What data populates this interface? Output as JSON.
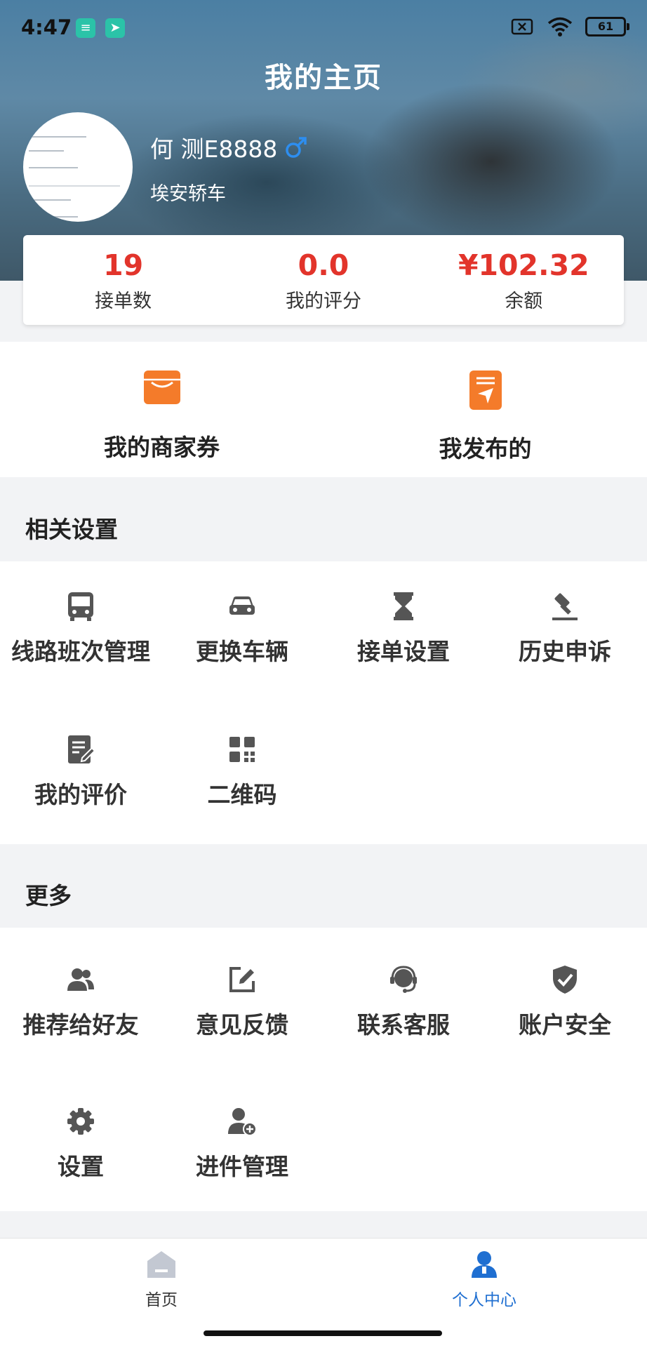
{
  "status_bar": {
    "time": "4:47",
    "battery": "61"
  },
  "header": {
    "title": "我的主页",
    "user_name": "何 测E8888",
    "car_type": "埃安轿车"
  },
  "stats": [
    {
      "value": "19",
      "label": "接单数"
    },
    {
      "value": "0.0",
      "label": "我的评分"
    },
    {
      "value": "¥102.32",
      "label": "余额"
    }
  ],
  "quick": [
    {
      "label": "我的商家券",
      "icon": "wallet-icon"
    },
    {
      "label": "我发布的",
      "icon": "send-icon"
    }
  ],
  "settings": {
    "title": "相关设置",
    "items": [
      {
        "label": "线路班次管理",
        "icon": "bus-icon"
      },
      {
        "label": "更换车辆",
        "icon": "car-icon"
      },
      {
        "label": "接单设置",
        "icon": "hourglass-icon"
      },
      {
        "label": "历史申诉",
        "icon": "gavel-icon"
      },
      {
        "label": "我的评价",
        "icon": "review-icon"
      },
      {
        "label": "二维码",
        "icon": "qrcode-icon"
      }
    ]
  },
  "more": {
    "title": "更多",
    "items": [
      {
        "label": "推荐给好友",
        "icon": "people-icon"
      },
      {
        "label": "意见反馈",
        "icon": "edit-icon"
      },
      {
        "label": "联系客服",
        "icon": "headset-icon"
      },
      {
        "label": "账户安全",
        "icon": "shield-icon"
      },
      {
        "label": "设置",
        "icon": "gear-icon"
      },
      {
        "label": "进件管理",
        "icon": "add-user-icon"
      }
    ]
  },
  "nav": [
    {
      "label": "首页",
      "icon": "home-icon",
      "active": false
    },
    {
      "label": "个人中心",
      "icon": "profile-icon",
      "active": true
    }
  ],
  "colors": {
    "accent": "#e2342b",
    "active_nav": "#1f6fd1",
    "quick_icon": "#f47b2a"
  }
}
